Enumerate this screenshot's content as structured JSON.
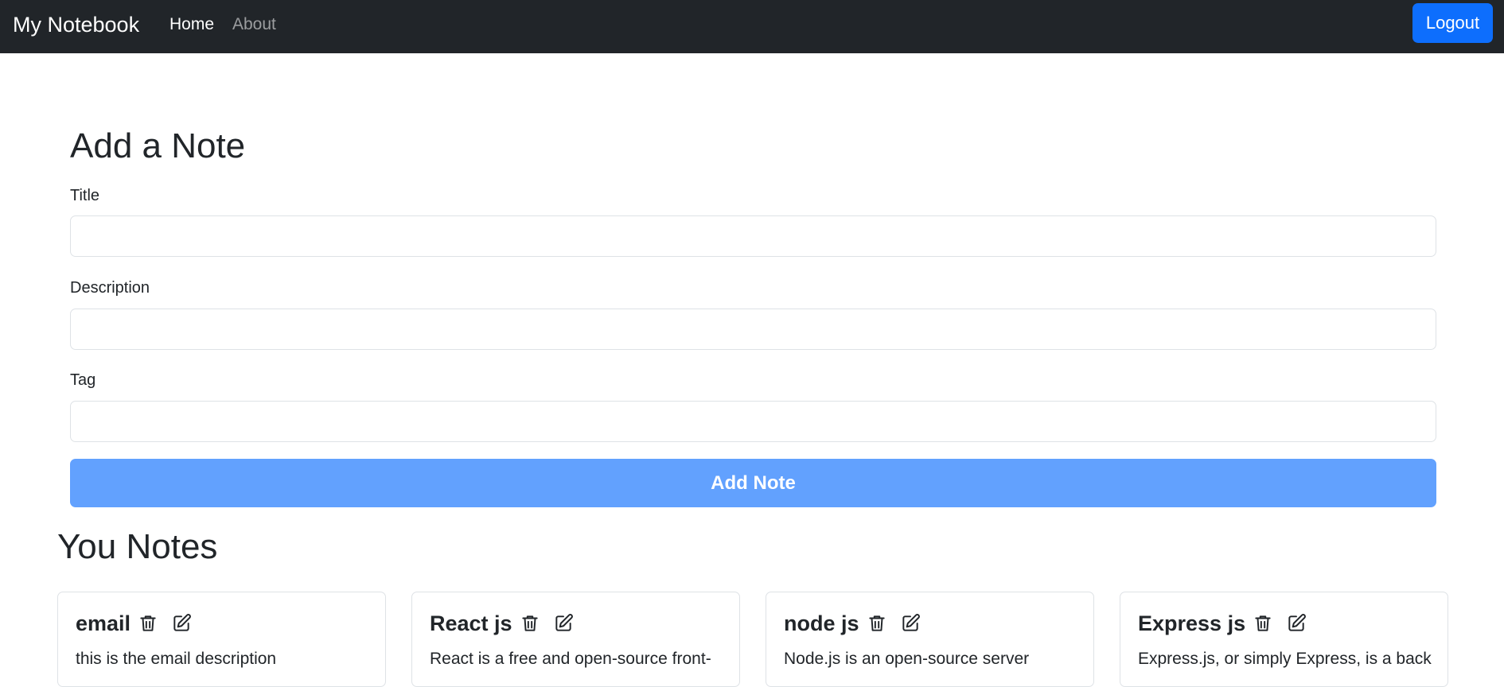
{
  "navbar": {
    "brand": "My Notebook",
    "links": [
      {
        "label": "Home"
      },
      {
        "label": "About"
      }
    ],
    "logout_label": "Logout"
  },
  "form": {
    "heading": "Add a Note",
    "title_label": "Title",
    "title_value": "",
    "description_label": "Description",
    "description_value": "",
    "tag_label": "Tag",
    "tag_value": "",
    "submit_label": "Add Note"
  },
  "notes": {
    "heading": "You Notes",
    "items": [
      {
        "title": "email",
        "description": "this is the email description",
        "icons": [
          "trash-icon",
          "edit-icon"
        ]
      },
      {
        "title": "React js",
        "description": "React is a free and open-source front-",
        "icons": [
          "trash-icon",
          "edit-icon"
        ]
      },
      {
        "title": "node js",
        "description": "Node.js is an open-source server",
        "icons": [
          "trash-icon",
          "edit-icon"
        ]
      },
      {
        "title": "Express js",
        "description": "Express.js, or simply Express, is a back",
        "icons": [
          "trash-icon",
          "edit-icon"
        ]
      }
    ]
  },
  "colors": {
    "navbar_bg": "#212529",
    "primary": "#0d6efd",
    "add_button_disabled": "#62a1fe",
    "text": "#212529",
    "border": "#dee2e6"
  }
}
